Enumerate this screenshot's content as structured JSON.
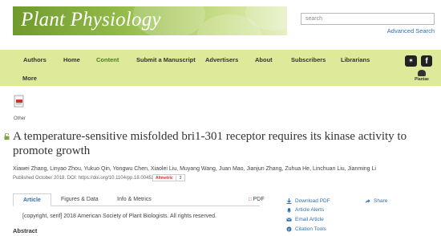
{
  "brand": {
    "journal_title": "Plant Physiology"
  },
  "search": {
    "placeholder": "search",
    "advanced_label": "Advanced Search"
  },
  "nav": {
    "items": [
      "Authors",
      "Home",
      "Content",
      "Submit a Manuscript",
      "Advertisers",
      "About",
      "Subscribers",
      "Librarians",
      "More"
    ],
    "active": "Content",
    "logo_text": "Plantae"
  },
  "article": {
    "section_label": "Other",
    "title": "A temperature-sensitive misfolded bri1-301 receptor requires its kinase activity to promote growth",
    "authors": "Xiawei Zhang, Linyao Zhou, Yukuo Qin, Yongwu Chen, Xiaolei Liu, Muyang Wang, Juan Mao, Jianjun Zhang, Zuhua He, Linchuan Liu, Jianming Li",
    "published": "Published October 2018. DOI: https://doi.org/10.1104/pp.18.00452",
    "altmetric_label": "Altmetric",
    "altmetric_count": "2"
  },
  "tabs": {
    "article": "Article",
    "figures": "Figures & Data",
    "info": "Info & Metrics",
    "pdf": "PDF"
  },
  "content": {
    "copyright": "[copyright, serif] 2018 American Society of Plant Biologists. All rights reserved.",
    "abstract_heading": "Abstract"
  },
  "sidebar": {
    "download_pdf": "Download PDF",
    "article_alerts": "Article Alerts",
    "email_article": "Email Article",
    "citation_tools": "Citation Tools",
    "share": "Share"
  },
  "colors": {
    "nav_bg": "#dfe99a",
    "active_nav": "#4b7d1f",
    "link": "#2f6fb0"
  }
}
